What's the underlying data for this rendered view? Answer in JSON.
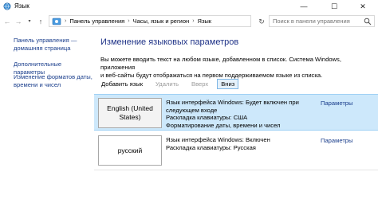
{
  "window": {
    "title": "Язык",
    "minimize_glyph": "—",
    "maximize_glyph": "☐",
    "close_glyph": "✕"
  },
  "nav": {
    "back_glyph": "←",
    "forward_glyph": "→",
    "history_glyph": "▾",
    "up_glyph": "↑",
    "refresh_glyph": "↻",
    "dropdown_glyph": "▾",
    "crumb_sep": "›"
  },
  "address": {
    "crumbs": [
      "Панель управления",
      "Часы, язык и регион",
      "Язык"
    ]
  },
  "search": {
    "placeholder": "Поиск в панели управления"
  },
  "sidebar": {
    "items": [
      {
        "label": "Панель управления —"
      },
      {
        "label": "домашняя страница"
      },
      {
        "label": "Дополнительные параметры"
      },
      {
        "label": "Изменение форматов даты,"
      },
      {
        "label": "времени и чисел"
      }
    ]
  },
  "main": {
    "heading": "Изменение языковых параметров",
    "desc_line1": "Вы можете вводить текст на любом языке, добавленном в список. Система Windows, приложения",
    "desc_line2": "и веб-сайты будут отображаться на первом поддерживаемом языке из списка.",
    "toolbar": {
      "add": "Добавить язык",
      "remove": "Удалить",
      "up": "Вверх",
      "down": "Вниз"
    },
    "languages": [
      {
        "name_line1": "English (United",
        "name_line2": "States)",
        "info": [
          "Язык интерфейса Windows: Будет включен при",
          "следующем входе",
          "Раскладка клавиатуры: США",
          "Форматирование даты, времени и чисел"
        ],
        "params": "Параметры"
      },
      {
        "name_line1": "русский",
        "info": [
          "Язык интерфейса Windows: Включен",
          "Раскладка клавиатуры: Русская"
        ],
        "params": "Параметры"
      }
    ]
  },
  "colors": {
    "link": "#1a3e8c",
    "heading": "#1e3287",
    "selected_row": "#cde8fb",
    "disabled_text": "#9a9a9a"
  }
}
